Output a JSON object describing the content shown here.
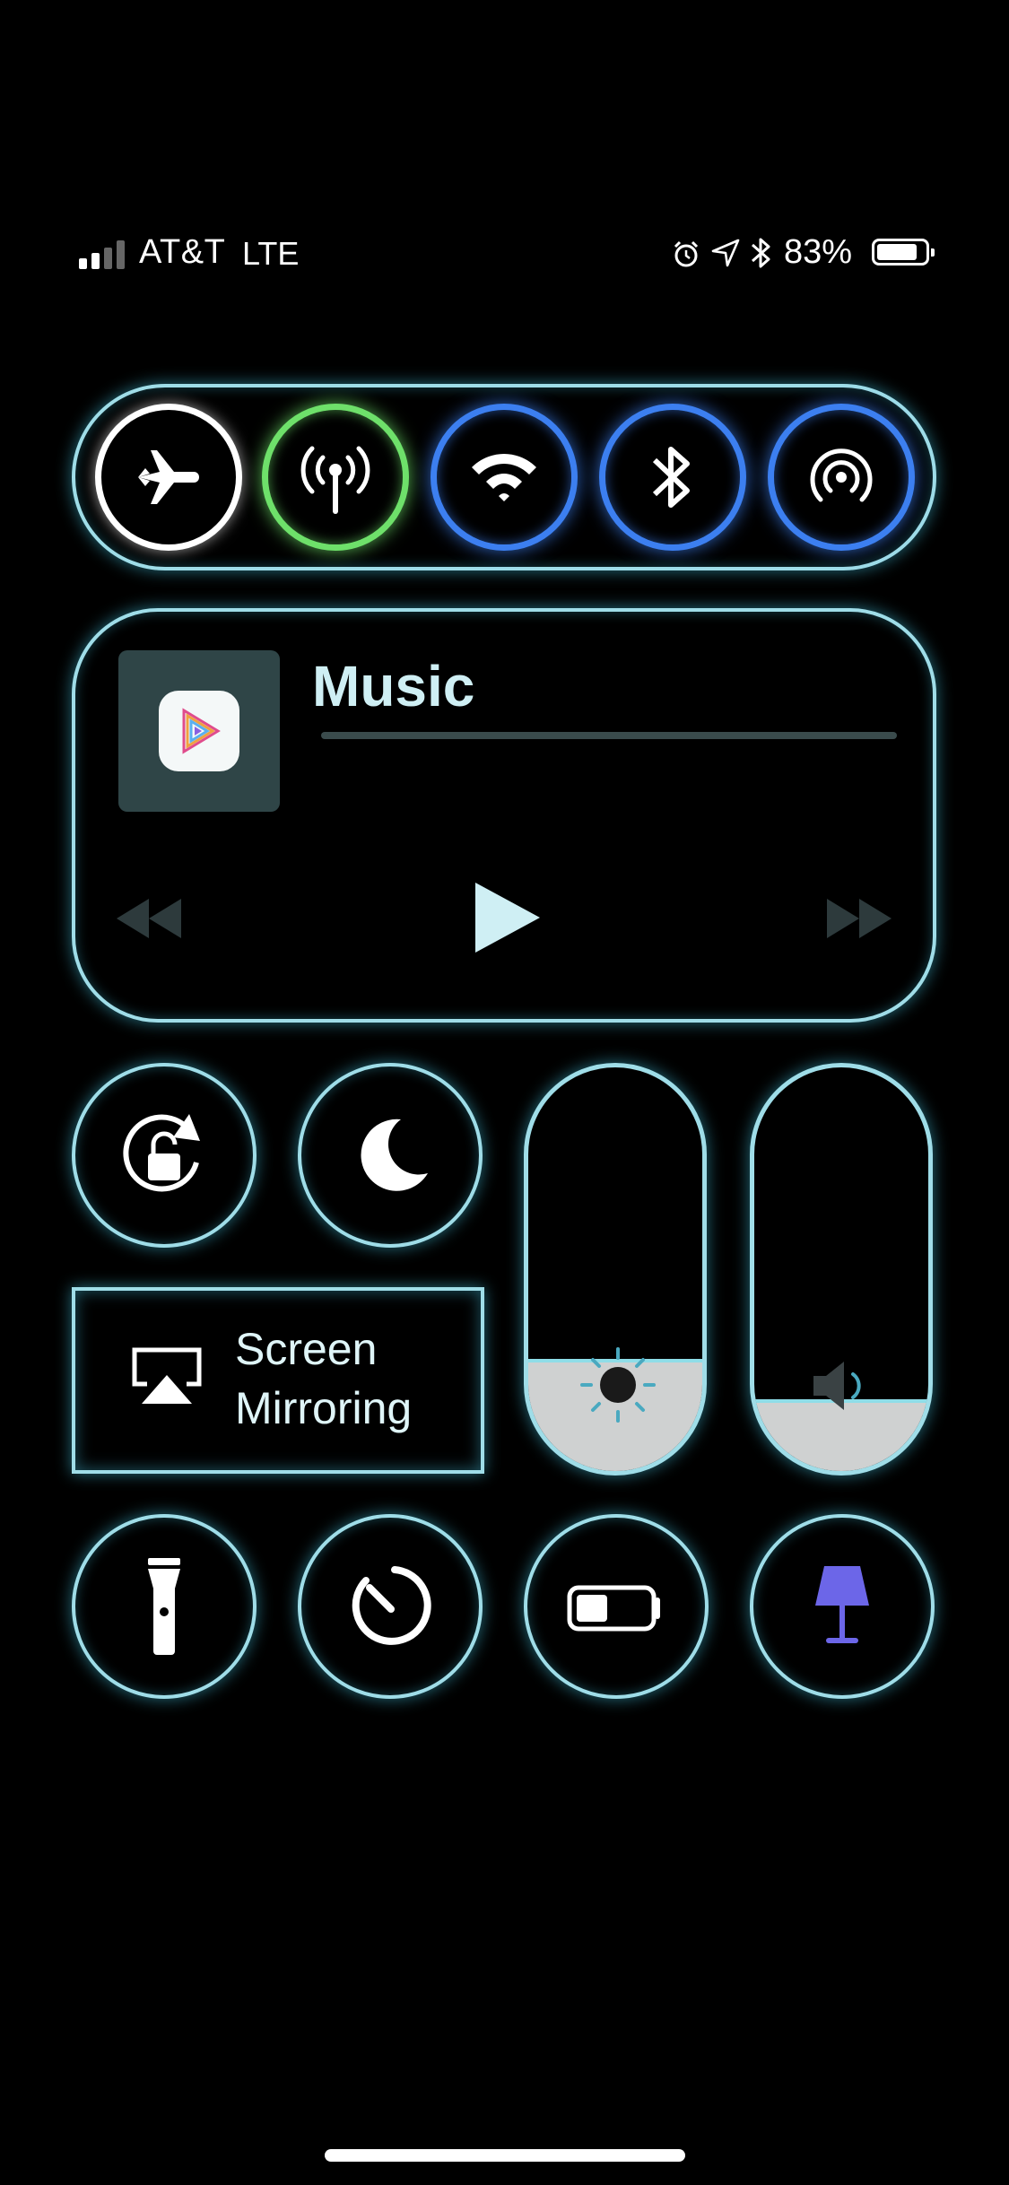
{
  "status_bar": {
    "carrier": "AT&T",
    "network": "LTE",
    "battery_percent": "83%",
    "signal_bars_active": 2,
    "signal_bars_total": 4,
    "icons": [
      "alarm-icon",
      "location-icon",
      "bluetooth-icon"
    ]
  },
  "connectivity": {
    "buttons": [
      {
        "name": "airplane-mode",
        "icon": "airplane-icon",
        "state": "off"
      },
      {
        "name": "cellular-data",
        "icon": "antenna-icon",
        "state": "on"
      },
      {
        "name": "wifi",
        "icon": "wifi-icon",
        "state": "on"
      },
      {
        "name": "bluetooth",
        "icon": "bluetooth-icon",
        "state": "on"
      },
      {
        "name": "airdrop",
        "icon": "airdrop-icon",
        "state": "on"
      }
    ]
  },
  "music": {
    "title": "Music",
    "progress": 0
  },
  "controls": {
    "screen_mirroring_label": "Screen Mirroring",
    "brightness_level": 0.27,
    "volume_level": 0.17
  },
  "colors": {
    "glow": "#9fdde8",
    "active_blue": "#3c7ff0",
    "active_green": "#6ee06a",
    "lamp_purple": "#6c66e8"
  }
}
